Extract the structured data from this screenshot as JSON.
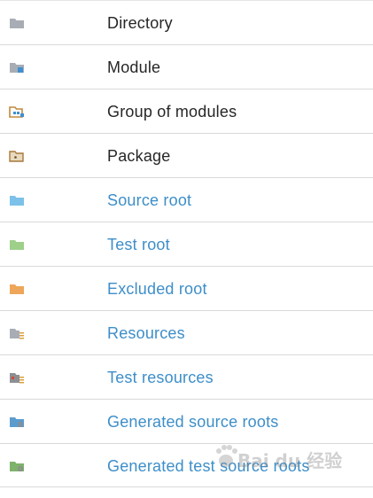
{
  "items": [
    {
      "label": "Directory",
      "color": "#262626",
      "icon": "directory-folder-icon"
    },
    {
      "label": "Module",
      "color": "#262626",
      "icon": "module-folder-icon"
    },
    {
      "label": "Group of modules",
      "color": "#262626",
      "icon": "group-of-modules-icon"
    },
    {
      "label": "Package",
      "color": "#262626",
      "icon": "package-folder-icon"
    },
    {
      "label": "Source root",
      "color": "#3d8ec9",
      "icon": "source-root-folder-icon"
    },
    {
      "label": "Test root",
      "color": "#3d8ec9",
      "icon": "test-root-folder-icon"
    },
    {
      "label": "Excluded root",
      "color": "#3d8ec9",
      "icon": "excluded-root-folder-icon"
    },
    {
      "label": "Resources",
      "color": "#3d8ec9",
      "icon": "resources-folder-icon"
    },
    {
      "label": "Test resources",
      "color": "#3d8ec9",
      "icon": "test-resources-folder-icon"
    },
    {
      "label": "Generated source roots",
      "color": "#3d8ec9",
      "icon": "generated-source-roots-icon"
    },
    {
      "label": "Generated test source roots",
      "color": "#3d8ec9",
      "icon": "generated-test-source-roots-icon"
    }
  ],
  "watermark": {
    "text": "Bai du 经验"
  }
}
